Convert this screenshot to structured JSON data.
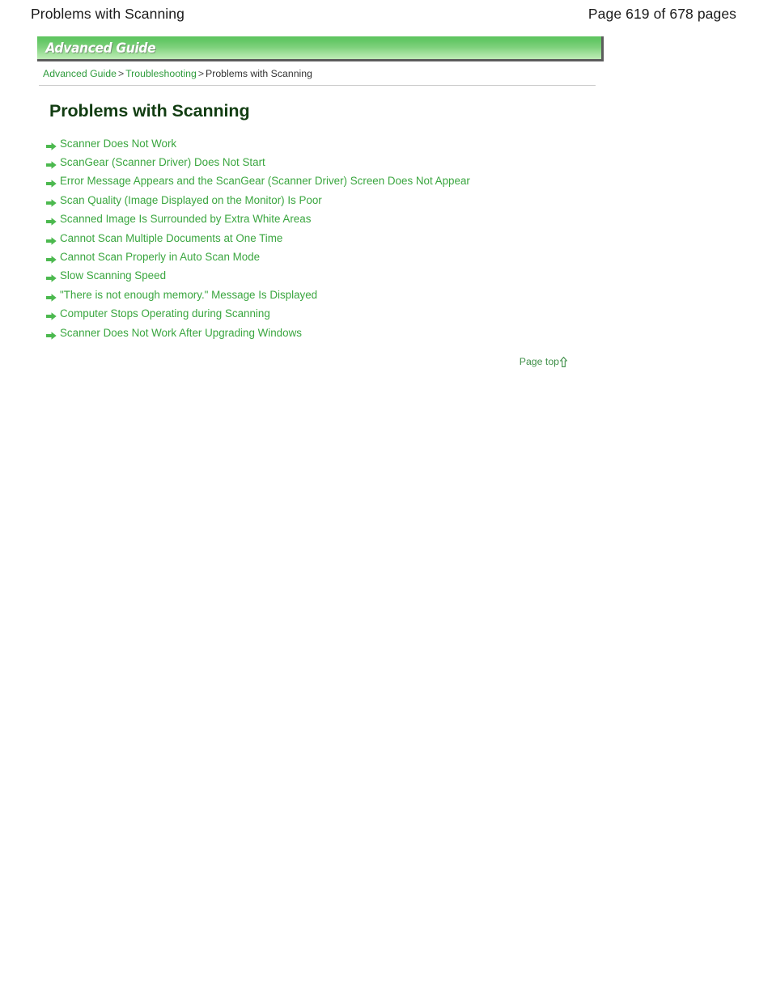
{
  "page_header": {
    "title": "Problems with Scanning",
    "page_counter": "Page 619 of 678 pages"
  },
  "banner": {
    "label": "Advanced Guide"
  },
  "breadcrumb": {
    "items": [
      {
        "label": "Advanced Guide",
        "type": "link"
      },
      {
        "label": "Troubleshooting",
        "type": "link"
      },
      {
        "label": "Problems with Scanning",
        "type": "current"
      }
    ],
    "separator": ">"
  },
  "main": {
    "heading": "Problems with Scanning",
    "links": [
      {
        "label": "Scanner Does Not Work",
        "icon": "arrow-right-icon"
      },
      {
        "label": "ScanGear (Scanner Driver) Does Not Start",
        "icon": "arrow-right-icon"
      },
      {
        "label": "Error Message Appears and the ScanGear (Scanner Driver) Screen Does Not Appear",
        "icon": "arrow-right-icon"
      },
      {
        "label": "Scan Quality (Image Displayed on the Monitor) Is Poor",
        "icon": "arrow-right-icon"
      },
      {
        "label": "Scanned Image Is Surrounded by Extra White Areas",
        "icon": "arrow-right-icon"
      },
      {
        "label": "Cannot Scan Multiple Documents at One Time",
        "icon": "arrow-right-icon"
      },
      {
        "label": "Cannot Scan Properly in Auto Scan Mode",
        "icon": "arrow-right-icon"
      },
      {
        "label": "Slow Scanning Speed",
        "icon": "arrow-right-icon"
      },
      {
        "label": "\"There is not enough memory.\" Message Is Displayed",
        "icon": "arrow-right-icon"
      },
      {
        "label": "Computer Stops Operating during Scanning",
        "icon": "arrow-right-icon"
      },
      {
        "label": "Scanner Does Not Work After Upgrading Windows",
        "icon": "arrow-right-icon"
      }
    ]
  },
  "footer": {
    "page_top_label": "Page top",
    "page_top_icon": "arrow-up-outline-icon"
  },
  "colors": {
    "link_green": "#3aa63f",
    "breadcrumb_green": "#2e9b3c",
    "heading_dark_green": "#123d12",
    "banner_green_top": "#5ec45f",
    "banner_green_bottom": "#bfecb7",
    "banner_border_gray": "#5c5c5c",
    "rule_gray": "#c9c9c9",
    "page_top_green": "#3f8f48"
  }
}
